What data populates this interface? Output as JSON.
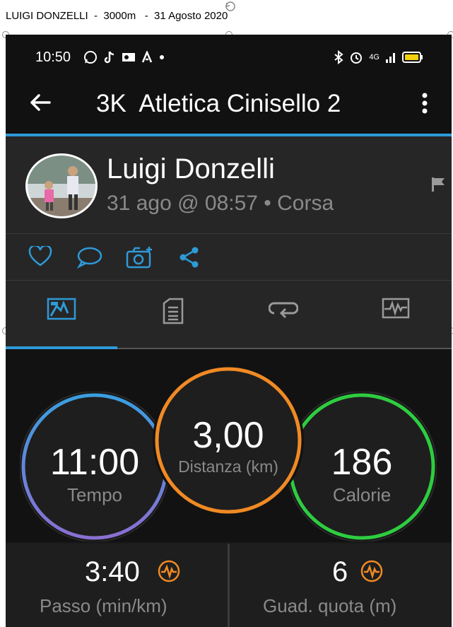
{
  "document": {
    "caption": "LUIGI DONZELLI  -  3000m   -  31 Agosto 2020"
  },
  "status_bar": {
    "time": "10:50",
    "network": "4G"
  },
  "app_bar": {
    "title": "3K  Atletica Cinisello 2"
  },
  "profile": {
    "name": "Luigi Donzelli",
    "meta": "31 ago @ 08:57 • Corsa"
  },
  "stats": {
    "tempo": {
      "value": "11:00",
      "label": "Tempo"
    },
    "distanza": {
      "value": "3,00",
      "label": "Distanza (km)"
    },
    "calorie": {
      "value": "186",
      "label": "Calorie"
    }
  },
  "metrics": {
    "passo": {
      "value": "3:40",
      "label": "Passo (min/km)"
    },
    "quota": {
      "value": "6",
      "label": "Guad. quota (m)"
    }
  },
  "colors": {
    "accent_blue": "#2e9ad8",
    "tempo_ring_start": "#3a9ee0",
    "tempo_ring_end": "#8a6fd0",
    "distanza_ring": "#f08a24",
    "calorie_ring": "#2ecc40",
    "metric_icon": "#f08a24"
  },
  "icons": {
    "back": "arrow-left-icon",
    "more": "more-vertical-icon",
    "flag": "flag-icon",
    "like": "heart-icon",
    "comment": "comment-icon",
    "photo": "camera-add-icon",
    "share": "share-icon",
    "tab_overview": "overview-icon",
    "tab_details": "details-icon",
    "tab_laps": "laps-icon",
    "tab_charts": "charts-icon",
    "metric": "pulse-icon"
  }
}
